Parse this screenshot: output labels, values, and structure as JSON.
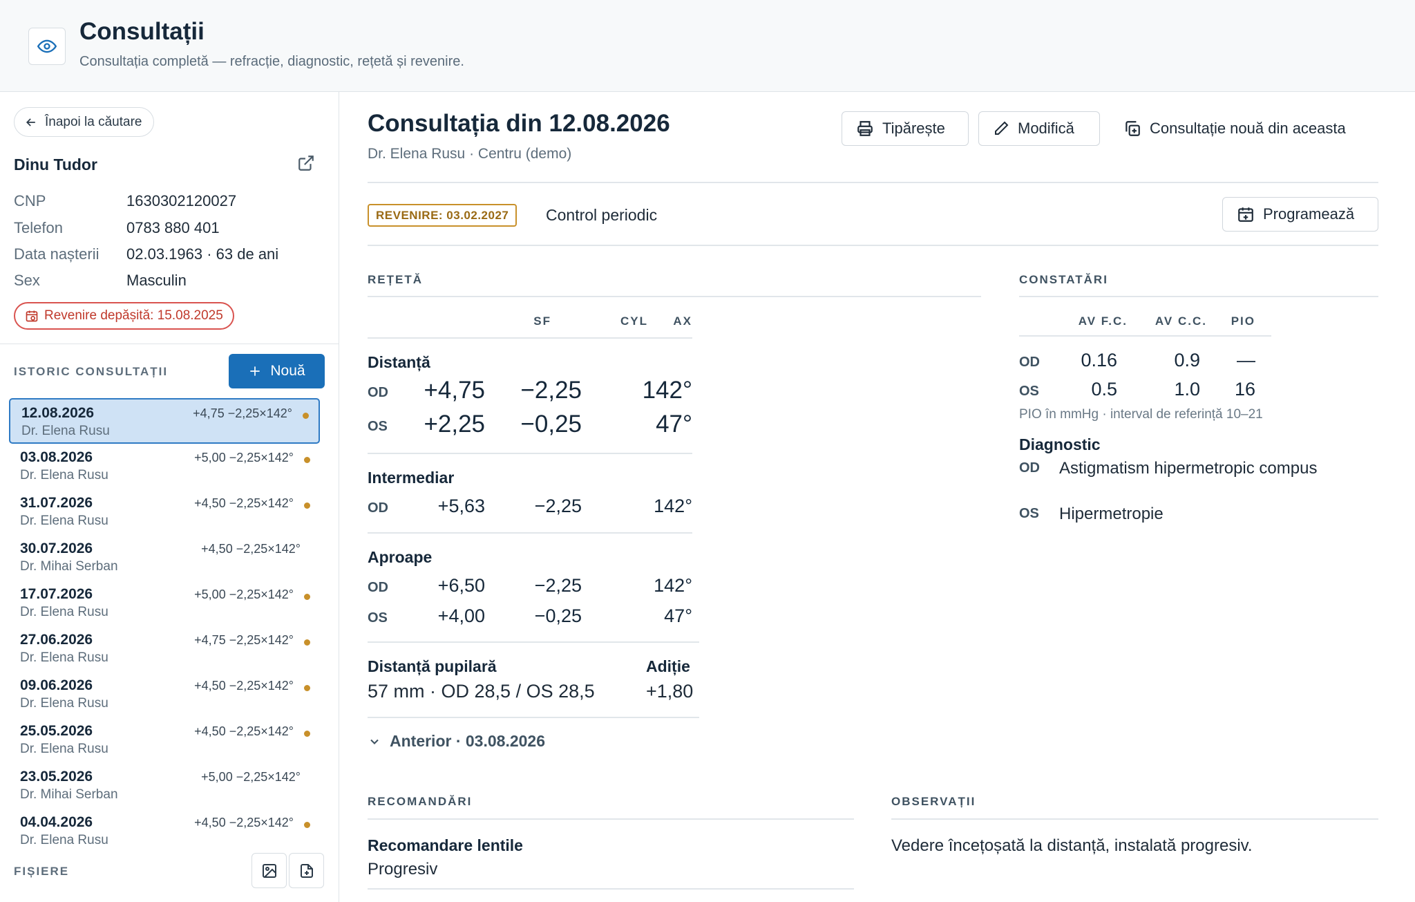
{
  "header": {
    "title": "Consultații",
    "subtitle": "Consultația completă — refracție, diagnostic, rețetă și revenire."
  },
  "sidebar": {
    "back_label": "Înapoi la căutare",
    "patient_name": "Dinu Tudor",
    "info": [
      {
        "key": "CNP",
        "value": "1630302120027"
      },
      {
        "key": "Telefon",
        "value": "0783 880 401"
      },
      {
        "key": "Data nașterii",
        "value": "02.03.1963 · 63 de ani"
      },
      {
        "key": "Sex",
        "value": "Masculin"
      }
    ],
    "overdue_label": "Revenire depășită: 15.08.2025",
    "history_label": "ISTORIC CONSULTAȚII",
    "new_label": "Nouă",
    "history": [
      {
        "date": "12.08.2026",
        "doctor": "Dr. Elena Rusu",
        "rx": "+4,75 −2,25×142°",
        "dot": true,
        "selected": true
      },
      {
        "date": "03.08.2026",
        "doctor": "Dr. Elena Rusu",
        "rx": "+5,00 −2,25×142°",
        "dot": true
      },
      {
        "date": "31.07.2026",
        "doctor": "Dr. Elena Rusu",
        "rx": "+4,50 −2,25×142°",
        "dot": true
      },
      {
        "date": "30.07.2026",
        "doctor": "Dr. Mihai Serban",
        "rx": "+4,50 −2,25×142°",
        "dot": false
      },
      {
        "date": "17.07.2026",
        "doctor": "Dr. Elena Rusu",
        "rx": "+5,00 −2,25×142°",
        "dot": true
      },
      {
        "date": "27.06.2026",
        "doctor": "Dr. Elena Rusu",
        "rx": "+4,75 −2,25×142°",
        "dot": true
      },
      {
        "date": "09.06.2026",
        "doctor": "Dr. Elena Rusu",
        "rx": "+4,50 −2,25×142°",
        "dot": true
      },
      {
        "date": "25.05.2026",
        "doctor": "Dr. Elena Rusu",
        "rx": "+4,50 −2,25×142°",
        "dot": true
      },
      {
        "date": "23.05.2026",
        "doctor": "Dr. Mihai Serban",
        "rx": "+5,00 −2,25×142°",
        "dot": false
      },
      {
        "date": "04.04.2026",
        "doctor": "Dr. Elena Rusu",
        "rx": "+4,50 −2,25×142°",
        "dot": true
      }
    ],
    "files_label": "FIȘIERE"
  },
  "main": {
    "title": "Consultația din 12.08.2026",
    "subtitle": "Dr. Elena Rusu · Centru (demo)",
    "print_label": "Tipărește",
    "edit_label": "Modifică",
    "new_from_label": "Consultație nouă din aceasta",
    "revisit_badge": "REVENIRE: 03.02.2027",
    "revisit_text": "Control periodic",
    "schedule_label": "Programează",
    "prescription": {
      "label": "REȚETĂ",
      "cols": [
        "SF",
        "CYL",
        "AX"
      ],
      "distance": {
        "title": "Distanță",
        "od": [
          "OD",
          "+4,75",
          "−2,25",
          "142°"
        ],
        "os": [
          "OS",
          "+2,25",
          "−0,25",
          "47°"
        ]
      },
      "intermediate": {
        "title": "Intermediar",
        "od": [
          "OD",
          "+5,63",
          "−2,25",
          "142°"
        ]
      },
      "near": {
        "title": "Aproape",
        "od": [
          "OD",
          "+6,50",
          "−2,25",
          "142°"
        ],
        "os": [
          "OS",
          "+4,00",
          "−0,25",
          "47°"
        ]
      },
      "pd_title": "Distanță pupilară",
      "pd_value": "57 mm · OD 28,5 / OS 28,5",
      "add_title": "Adiție",
      "add_value": "+1,80",
      "previous": "Anterior · 03.08.2026"
    },
    "findings": {
      "label": "CONSTATĂRI",
      "cols": [
        "AV F.C.",
        "AV C.C.",
        "PIO"
      ],
      "od": [
        "OD",
        "0.16",
        "0.9",
        "—"
      ],
      "os": [
        "OS",
        "0.5",
        "1.0",
        "16"
      ],
      "note": "PIO în mmHg · interval de referință 10–21",
      "diagnosis_title": "Diagnostic",
      "diag_od": [
        "OD",
        "Astigmatism hipermetropic compus"
      ],
      "diag_os": [
        "OS",
        "Hipermetropie"
      ]
    },
    "recommendations": {
      "label": "RECOMANDĂRI",
      "title": "Recomandare lentile",
      "value": "Progresiv"
    },
    "observations": {
      "label": "OBSERVAȚII",
      "value": "Vedere încețoșată la distanță, instalată progresiv."
    }
  }
}
